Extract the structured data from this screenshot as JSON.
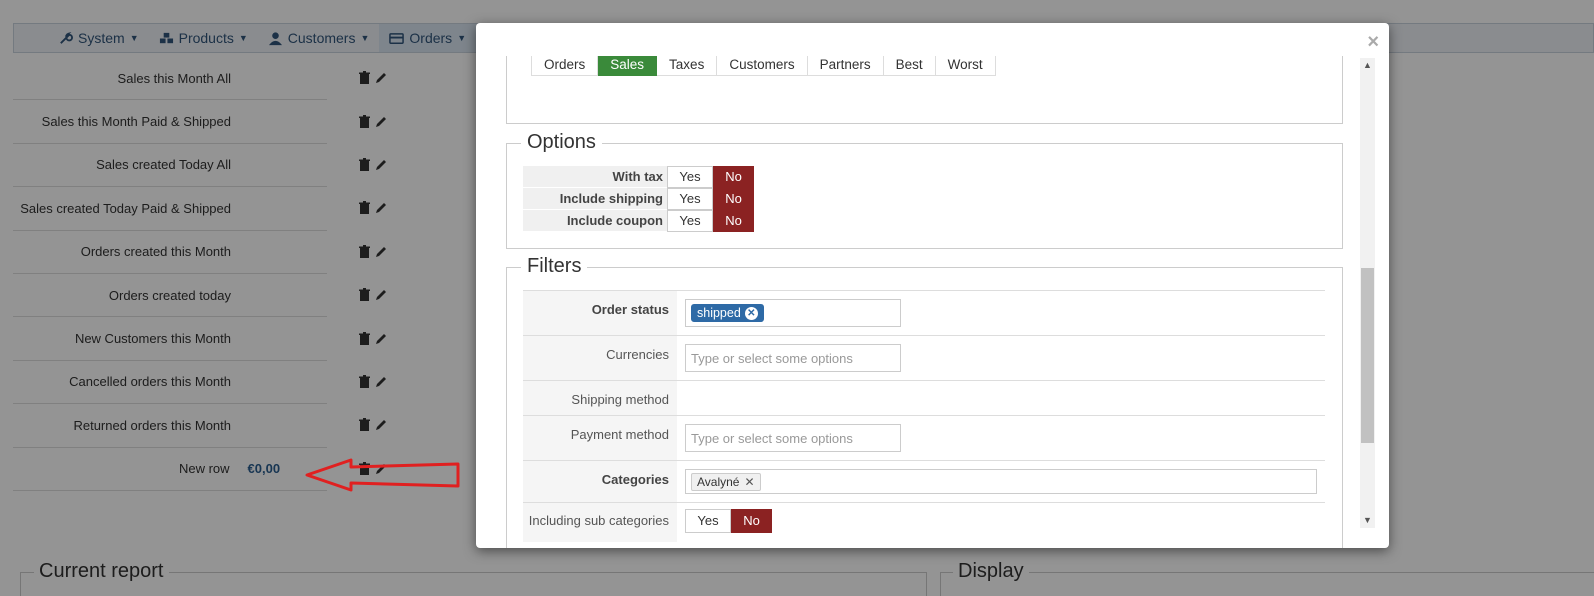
{
  "nav": {
    "items": [
      {
        "label": "System"
      },
      {
        "label": "Products"
      },
      {
        "label": "Customers"
      },
      {
        "label": "Orders"
      }
    ]
  },
  "kpis": [
    {
      "label": "Sales this Month All"
    },
    {
      "label": "Sales this Month Paid & Shipped"
    },
    {
      "label": "Sales created Today All"
    },
    {
      "label": "Sales created Today Paid & Shipped"
    },
    {
      "label": "Orders created this Month"
    },
    {
      "label": "Orders created today"
    },
    {
      "label": "New Customers this Month"
    },
    {
      "label": "Cancelled orders this Month"
    },
    {
      "label": "Returned orders this Month"
    },
    {
      "label": "New row",
      "value": "€0,00"
    }
  ],
  "sections": {
    "current_report": "Current report",
    "display": "Display"
  },
  "modal": {
    "close": "×",
    "tabs": [
      "Orders",
      "Sales",
      "Taxes",
      "Customers",
      "Partners",
      "Best",
      "Worst"
    ],
    "active_tab": "Sales",
    "options": {
      "legend": "Options",
      "rows": [
        {
          "label": "With tax",
          "yes": "Yes",
          "no": "No",
          "selected": "No"
        },
        {
          "label": "Include shipping",
          "yes": "Yes",
          "no": "No",
          "selected": "No"
        },
        {
          "label": "Include coupon",
          "yes": "Yes",
          "no": "No",
          "selected": "No"
        }
      ]
    },
    "filters": {
      "legend": "Filters",
      "order_status": {
        "label": "Order status",
        "chip": "shipped"
      },
      "currencies": {
        "label": "Currencies",
        "placeholder": "Type or select some options"
      },
      "shipping_method": {
        "label": "Shipping method"
      },
      "payment_method": {
        "label": "Payment method",
        "placeholder": "Type or select some options"
      },
      "categories": {
        "label": "Categories",
        "chip": "Avalyné"
      },
      "sub_categories": {
        "label": "Including sub categories",
        "yes": "Yes",
        "no": "No",
        "selected": "No"
      }
    }
  },
  "colors": {
    "accent_green": "#3a8a3a",
    "danger_red": "#8b2222",
    "chip_blue": "#2e6aa6",
    "arrow_red": "#e02020"
  }
}
